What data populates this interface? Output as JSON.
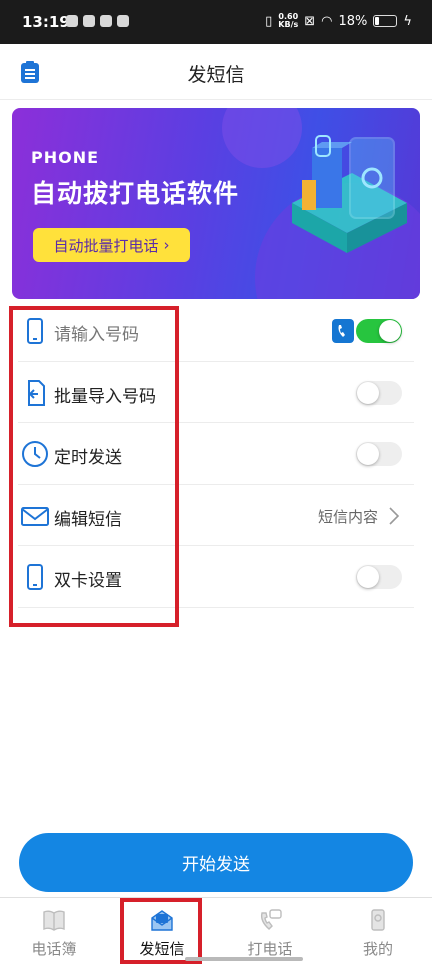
{
  "status_bar": {
    "time": "13:19",
    "speed_value": "0.60",
    "speed_unit": "KB/s",
    "battery": "18%",
    "battery_level": 0.18
  },
  "header": {
    "title": "发短信",
    "contacts_icon": "clipboard-icon"
  },
  "banner": {
    "small_text": "PHONE",
    "big_text": "自动拔打电话软件",
    "button_label": "自动批量打电话",
    "button_arrow": "›"
  },
  "rows": {
    "phone_input": {
      "placeholder": "请输入号码",
      "icon": "mobile-phone-icon",
      "toggle_on": true
    },
    "batch_import": {
      "label": "批量导入号码",
      "icon": "file-import-icon",
      "toggle_on": false
    },
    "scheduled_send": {
      "label": "定时发送",
      "icon": "clock-icon",
      "toggle_on": false
    },
    "edit_sms": {
      "label": "编辑短信",
      "icon": "envelope-icon",
      "value": "短信内容"
    },
    "dual_sim": {
      "label": "双卡设置",
      "icon": "mobile-phone-icon",
      "toggle_on": false
    }
  },
  "start_button": {
    "label": "开始发送"
  },
  "tabs": [
    {
      "label": "电话簿",
      "icon": "book-icon",
      "active": false
    },
    {
      "label": "发短信",
      "icon": "message-envelope-icon",
      "active": true
    },
    {
      "label": "打电话",
      "icon": "phone-call-icon",
      "active": false
    },
    {
      "label": "我的",
      "icon": "user-icon",
      "active": false
    }
  ],
  "colors": {
    "accent": "#1486e3",
    "toggle_on": "#27c53f",
    "highlight": "#d6202a",
    "banner_button": "#ffe13b"
  }
}
